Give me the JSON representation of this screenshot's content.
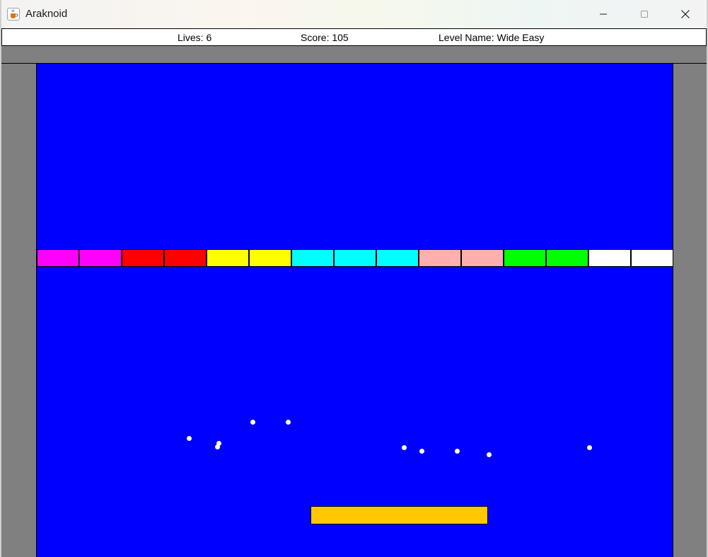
{
  "window": {
    "title": "Araknoid",
    "icon": "java-cup-icon",
    "controls": {
      "minimize_icon": "minimize-icon",
      "maximize_icon": "maximize-icon",
      "close_icon": "close-icon"
    }
  },
  "status": {
    "lives_text": "Lives: 6",
    "score_text": "Score: 105",
    "level_text": "Level Name: Wide Easy"
  },
  "colors": {
    "field": "#0000ff",
    "walls": "#808080",
    "ball": "#ffffff",
    "paddle": "#ffc800"
  },
  "bricks": [
    {
      "color": "#ff00ff"
    },
    {
      "color": "#ff00ff"
    },
    {
      "color": "#ff0000"
    },
    {
      "color": "#ff0000"
    },
    {
      "color": "#ffff00"
    },
    {
      "color": "#ffff00"
    },
    {
      "color": "#00ffff"
    },
    {
      "color": "#00ffff"
    },
    {
      "color": "#00ffff"
    },
    {
      "color": "#ffafaf"
    },
    {
      "color": "#ffafaf"
    },
    {
      "color": "#00ff00"
    },
    {
      "color": "#00ff00"
    },
    {
      "color": "#ffffff"
    },
    {
      "color": "#ffffff"
    }
  ],
  "ball_count": 10
}
